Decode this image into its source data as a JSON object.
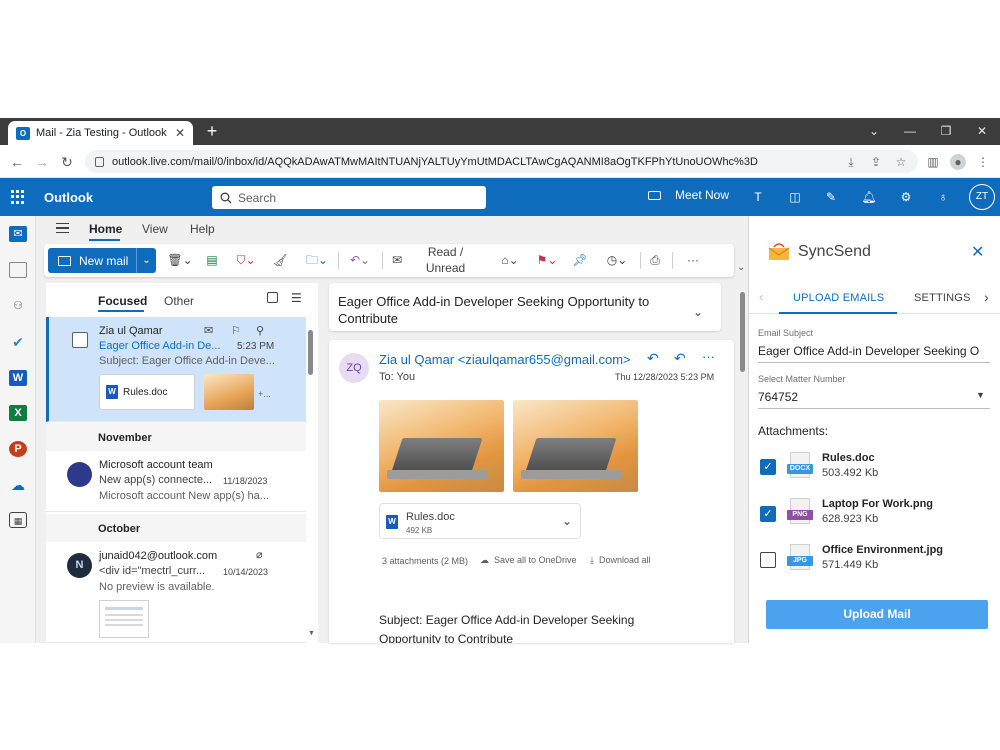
{
  "browser": {
    "tab_title": "Mail - Zia Testing - Outlook",
    "url": "outlook.live.com/mail/0/inbox/id/AQQkADAwATMwMAItNTUANjYALTUyYmUtMDACLTAwCgAQANMI8aOgTKFPhYtUnoUOWhc%3D"
  },
  "outlook": {
    "brand": "Outlook",
    "search_placeholder": "Search",
    "meet_now": "Meet Now",
    "avatar_initials": "ZT",
    "accent": "#0f6cbd"
  },
  "menu": {
    "home": "Home",
    "view": "View",
    "help": "Help"
  },
  "ribbon": {
    "new_mail": "New mail",
    "read_unread": "Read / Unread",
    "more": "···"
  },
  "list": {
    "focused": "Focused",
    "other": "Other",
    "selected": {
      "sender": "Zia ul Qamar",
      "subject": "Eager Office Add-in De...",
      "time": "5:23 PM",
      "preview": "Subject: Eager Office Add-in Deve...",
      "attachment": "Rules.doc",
      "more": "+..."
    },
    "group_november": "November",
    "ms": {
      "sender": "Microsoft account team",
      "subject": "New app(s) connecte...",
      "date": "11/18/2023",
      "preview": "Microsoft account New app(s) ha..."
    },
    "group_october": "October",
    "junaid": {
      "sender": "junaid042@outlook.com",
      "subject": "<div id=\"mectrl_curr...",
      "date": "10/14/2023",
      "preview": "No preview is available."
    }
  },
  "reading": {
    "subject": "Eager Office Add-in Developer Seeking Opportunity to Contribute",
    "avatar": "ZQ",
    "from": "Zia ul Qamar <ziaulqamar655@gmail.com>",
    "to": "To:  You",
    "date": "Thu 12/28/2023 5:23 PM",
    "attachment_name": "Rules.doc",
    "attachment_size": "492 KB",
    "attachments_summary": "3 attachments (2 MB)",
    "save_onedrive": "Save all to OneDrive",
    "download_all": "Download all",
    "body_line1": "Subject: Eager Office Add-in Developer Seeking",
    "body_line2": "Opportunity to Contribute"
  },
  "addin": {
    "name": "SyncSend",
    "tab_upload": "UPLOAD EMAILS",
    "tab_settings": "SETTINGS",
    "email_subject_label": "Email Subject",
    "email_subject_value": "Eager Office Add-in Developer Seeking O",
    "matter_label": "Select Matter Number",
    "matter_value": "764752",
    "attachments_label": "Attachments:",
    "files": [
      {
        "name": "Rules.doc",
        "size": "503.492 Kb",
        "badge": "DOCX",
        "checked": true,
        "color": "#3a96dd"
      },
      {
        "name": "Laptop For Work.png",
        "size": "628.923 Kb",
        "badge": "PNG",
        "checked": true,
        "color": "#8f4fa3"
      },
      {
        "name": "Office Environment.jpg",
        "size": "571.449 Kb",
        "badge": "JPG",
        "checked": false,
        "color": "#3a96dd"
      }
    ],
    "upload_button": "Upload Mail",
    "button_color": "#4ba3ef"
  }
}
